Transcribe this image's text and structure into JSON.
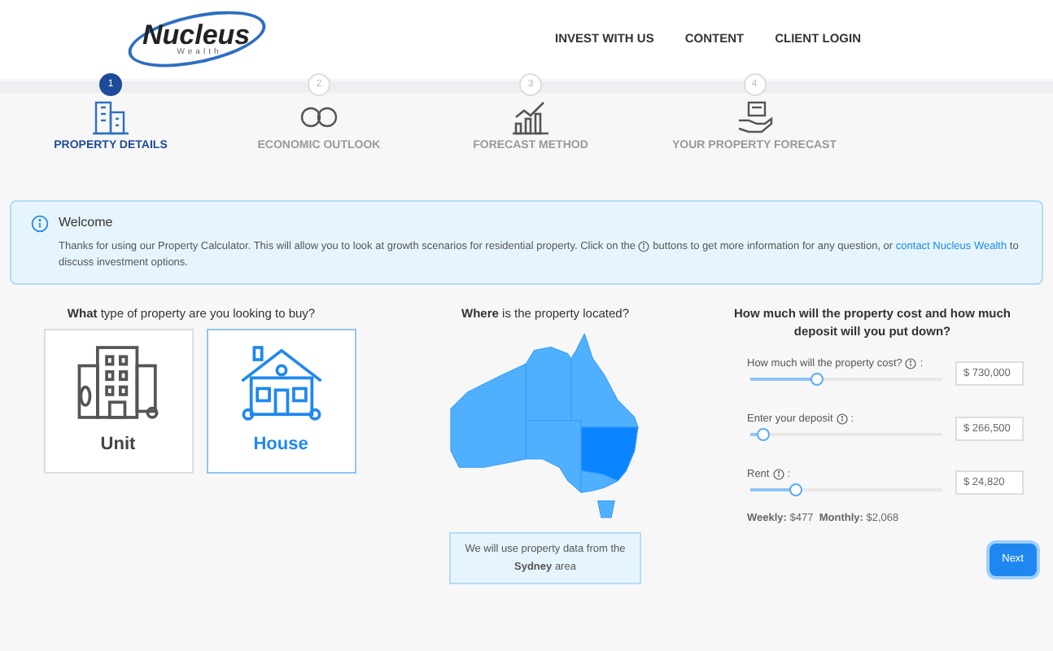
{
  "header": {
    "logo": {
      "name": "Nucleus",
      "tagline": "Wealth"
    },
    "nav": [
      "INVEST WITH US",
      "CONTENT",
      "CLIENT LOGIN"
    ]
  },
  "steps": [
    {
      "number": "1",
      "label": "PROPERTY DETAILS",
      "selected": true,
      "kind": "building"
    },
    {
      "number": "2",
      "label": "ECONOMIC OUTLOOK",
      "selected": false,
      "kind": "coins"
    },
    {
      "number": "3",
      "label": "FORECAST METHOD",
      "selected": false,
      "kind": "chart"
    },
    {
      "number": "4",
      "label": "YOUR PROPERTY FORECAST",
      "selected": false,
      "kind": "hand"
    }
  ],
  "welcome": {
    "title": "Welcome",
    "text_before": "Thanks for using our Property Calculator. This will allow you to look at growth scenarios for residential property. Click on the",
    "text_after": "buttons to get more information for any question, or",
    "link": "contact Nucleus Wealth",
    "text_end": "to discuss investment options."
  },
  "property_type": {
    "question": "**What** type of property are you looking to buy?",
    "options": [
      {
        "label": "Unit",
        "kind": "unit",
        "selected": false
      },
      {
        "label": "House",
        "kind": "house",
        "selected": true
      }
    ]
  },
  "location": {
    "question": "**Where** is the property located?",
    "states": [
      {
        "selected": false
      },
      {
        "selected": false
      },
      {
        "selected": false
      },
      {
        "selected": false
      },
      {
        "selected": true
      },
      {
        "selected": false
      },
      {
        "selected": false
      }
    ],
    "note": "We will use property data from the **Sydney** area"
  },
  "cost": {
    "question": "How much will the property cost and how much deposit will you put down?",
    "sliders": [
      {
        "label": "How much will the property cost?",
        "suffix": ":",
        "level": 0.35,
        "value": "$ 730,000"
      },
      {
        "label": "Enter your deposit",
        "suffix": ":",
        "level": 0.07,
        "value": "$ 266,500"
      },
      {
        "label": "Rent",
        "suffix": ":",
        "level": 0.24,
        "value": "$ 24,820"
      }
    ],
    "summary": "**Weekly:** $477  **Monthly:** $2,068"
  },
  "next_button": "Next"
}
